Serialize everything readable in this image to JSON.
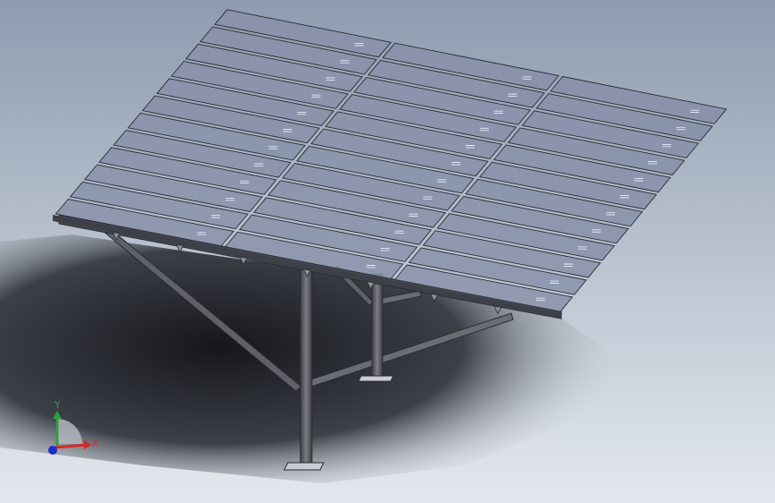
{
  "viewport": {
    "background_top": "#8e9cb0",
    "background_bottom": "#e4e8ee",
    "shadow": "#1c1e22"
  },
  "model": {
    "name": "",
    "panel_color": "#8a93ab",
    "panel_edge": "#2a2d34",
    "frame_color": "#5c5f66",
    "panel_columns": 3,
    "panel_rows": 12
  },
  "triad": {
    "x_label": "X",
    "y_label": "Y",
    "x_color": "#d42a2a",
    "y_color": "#2fa13a",
    "z_color": "#1d2fd1"
  }
}
